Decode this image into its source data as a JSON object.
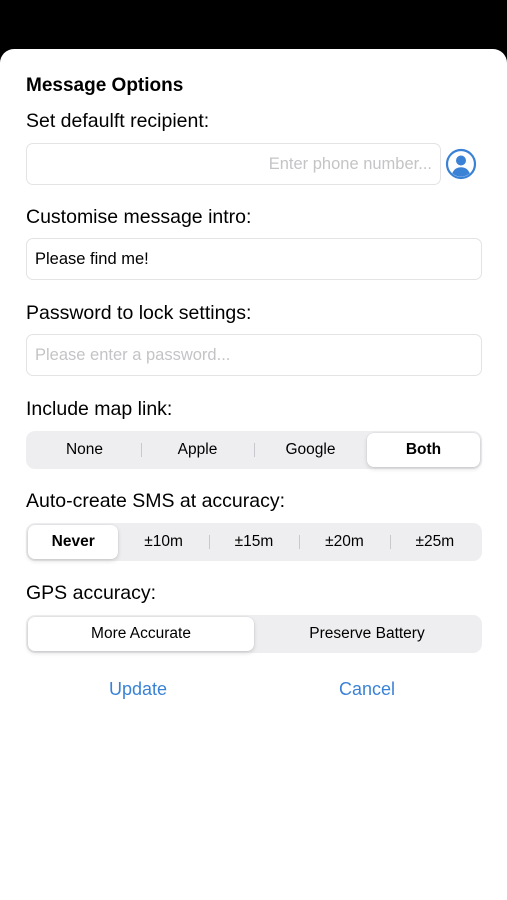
{
  "colors": {
    "accent": "#3a82d6",
    "background": "#000000",
    "sheet": "#ffffff",
    "segment_track": "#eeeef0"
  },
  "heading": "Message Options",
  "recipient": {
    "label": "Set defaulft recipient:",
    "value": "",
    "placeholder": "Enter phone number...",
    "contact_icon": "person-circle-icon"
  },
  "intro": {
    "label": "Customise message intro:",
    "value": "Please find me!",
    "placeholder": ""
  },
  "password": {
    "label": "Password to lock settings:",
    "value": "",
    "placeholder": "Please enter a password..."
  },
  "map_link": {
    "label": "Include map link:",
    "options": [
      "None",
      "Apple",
      "Google",
      "Both"
    ],
    "selected": "Both"
  },
  "auto_sms": {
    "label": "Auto-create SMS at accuracy:",
    "options": [
      "Never",
      "±10m",
      "±15m",
      "±20m",
      "±25m"
    ],
    "selected": "Never"
  },
  "gps": {
    "label": "GPS accuracy:",
    "options": [
      "More Accurate",
      "Preserve Battery"
    ],
    "selected": "More Accurate"
  },
  "actions": {
    "update": "Update",
    "cancel": "Cancel"
  }
}
